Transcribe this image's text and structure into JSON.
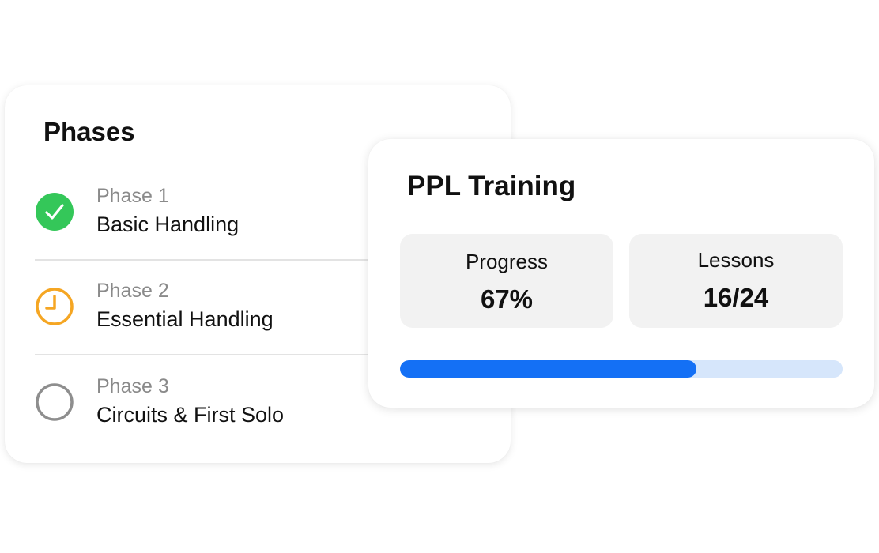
{
  "phases_card": {
    "title": "Phases",
    "items": [
      {
        "label": "Phase 1",
        "name": "Basic Handling",
        "status": "completed",
        "icon": "check-circle-icon",
        "color": "#34c759"
      },
      {
        "label": "Phase 2",
        "name": "Essential Handling",
        "status": "in-progress",
        "icon": "clock-icon",
        "color": "#f5a623"
      },
      {
        "label": "Phase 3",
        "name": "Circuits & First Solo",
        "status": "not-started",
        "icon": "empty-circle-icon",
        "color": "#8e8e8e"
      }
    ]
  },
  "training_card": {
    "title": "PPL Training",
    "progress": {
      "label": "Progress",
      "value": "67%"
    },
    "lessons": {
      "label": "Lessons",
      "value": "16/24"
    },
    "progress_bar": {
      "fraction": 0.67,
      "fill_color": "#1470f5",
      "track_color": "#d6e6fb"
    }
  }
}
